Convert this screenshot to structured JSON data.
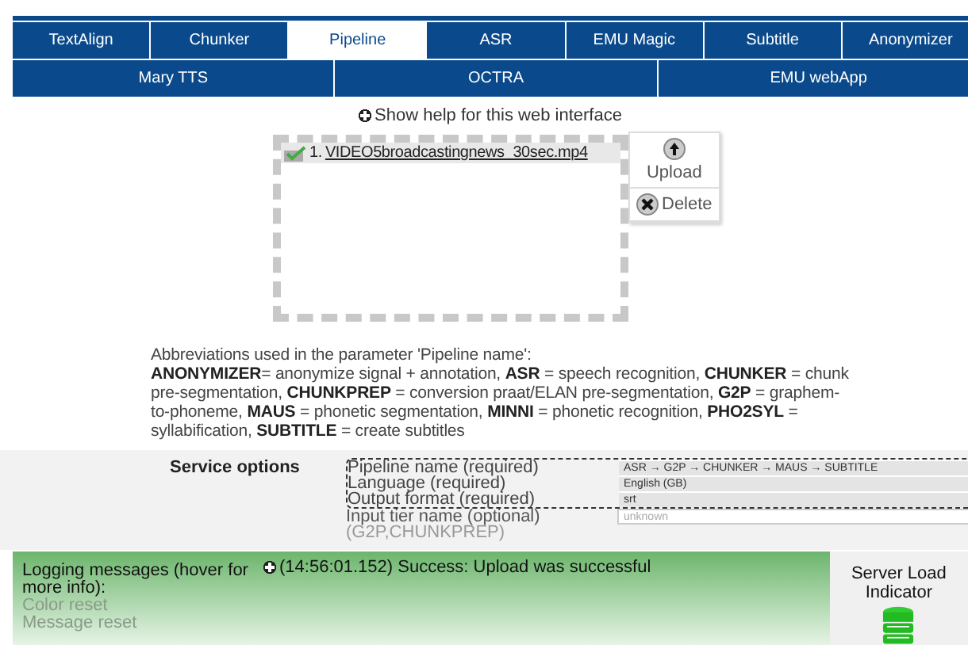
{
  "tabs_row_1": [
    {
      "label": "TextAlign",
      "selected": false
    },
    {
      "label": "Chunker",
      "selected": false
    },
    {
      "label": "Pipeline",
      "selected": true
    },
    {
      "label": "ASR",
      "selected": false
    },
    {
      "label": "EMU Magic",
      "selected": false
    },
    {
      "label": "Subtitle",
      "selected": false
    },
    {
      "label": "Anonymizer",
      "selected": false
    }
  ],
  "tabs_row_2": [
    {
      "label": "Mary TTS",
      "selected": false
    },
    {
      "label": "OCTRA",
      "selected": false
    },
    {
      "label": "EMU webApp",
      "selected": false
    }
  ],
  "help_link": "Show help for this web interface",
  "files": [
    {
      "number": "1.",
      "name": "VIDEO5broadcastingnews_30sec.mp4",
      "uploaded": true
    }
  ],
  "file_buttons": [
    {
      "kind": "upload",
      "label": "Upload"
    },
    {
      "kind": "delete",
      "label": "Delete"
    }
  ],
  "abbreviations": {
    "intro": "Abbreviations used in the parameter 'Pipeline name':",
    "text": "**ANONYMIZER**= anonymize signal + annotation, **ASR** = speech recognition, **CHUNKER** = chunk pre-segmentation, **CHUNKPREP** = conversion praat/ELAN pre-segmentation, **G2P** = graphem-to-phoneme, **MAUS** = phonetic segmentation, **MINNI** = phonetic recognition, **PHO2SYL** = syllabification, **SUBTITLE** = create subtitles"
  },
  "service_options": {
    "title": "Service options",
    "options": [
      {
        "label": "Pipeline name (required)",
        "value": "ASR → G2P → CHUNKER → MAUS → SUBTITLE",
        "required": true
      },
      {
        "label": "Language (required)",
        "value": "English (GB)",
        "required": true
      },
      {
        "label": "Output format (required)",
        "value": "srt",
        "required": true
      },
      {
        "label": "Input tier name (optional)",
        "note": "(G2P,CHUNKPREP)",
        "placeholder": "unknown",
        "required": false
      }
    ]
  },
  "logging": {
    "title": "Logging messages (hover for more info):",
    "links": [
      "Color reset",
      "Message reset"
    ],
    "messages": [
      "(14:56:01.152) Success: Upload was successful"
    ]
  },
  "server_load": {
    "title": "Server Load Indicator"
  }
}
